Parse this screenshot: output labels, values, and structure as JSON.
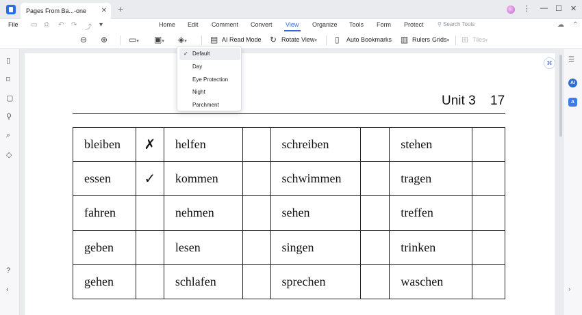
{
  "titlebar": {
    "tab_title": "Pages From Ba...-one page.pdf",
    "tab_close": "✕",
    "tab_add": "+",
    "window_controls": {
      "more": "⋮",
      "minimize": "—",
      "maximize": "☐",
      "close": "✕"
    }
  },
  "menubar": {
    "file": "File",
    "nav": [
      "Home",
      "Edit",
      "Comment",
      "Convert",
      "View",
      "Organize",
      "Tools",
      "Form",
      "Protect"
    ],
    "active": "View",
    "search_placeholder": "Search Tools"
  },
  "toolbar": {
    "ai_read_mode": "AI Read Mode",
    "rotate_view": "Rotate View",
    "auto_bookmarks": "Auto Bookmarks",
    "rulers": "Rulers",
    "grids": "Grids",
    "tiles": "Tiles"
  },
  "dropdown": {
    "items": [
      "Default",
      "Day",
      "Eye Protection",
      "Night",
      "Parchment"
    ],
    "selected": "Default"
  },
  "document": {
    "header": "Unit 3",
    "page_number": "17",
    "table": [
      [
        "bleiben",
        "✗",
        "helfen",
        "",
        "schreiben",
        "",
        "stehen",
        ""
      ],
      [
        "essen",
        "✓",
        "kommen",
        "",
        "schwimmen",
        "",
        "tragen",
        ""
      ],
      [
        "fahren",
        "",
        "nehmen",
        "",
        "sehen",
        "",
        "treffen",
        ""
      ],
      [
        "geben",
        "",
        "lesen",
        "",
        "singen",
        "",
        "trinken",
        ""
      ],
      [
        "gehen",
        "",
        "schlafen",
        "",
        "sprechen",
        "",
        "waschen",
        ""
      ]
    ]
  },
  "colors": {
    "accent": "#2f6bd8",
    "ai_blue": "#2f6bd8"
  }
}
